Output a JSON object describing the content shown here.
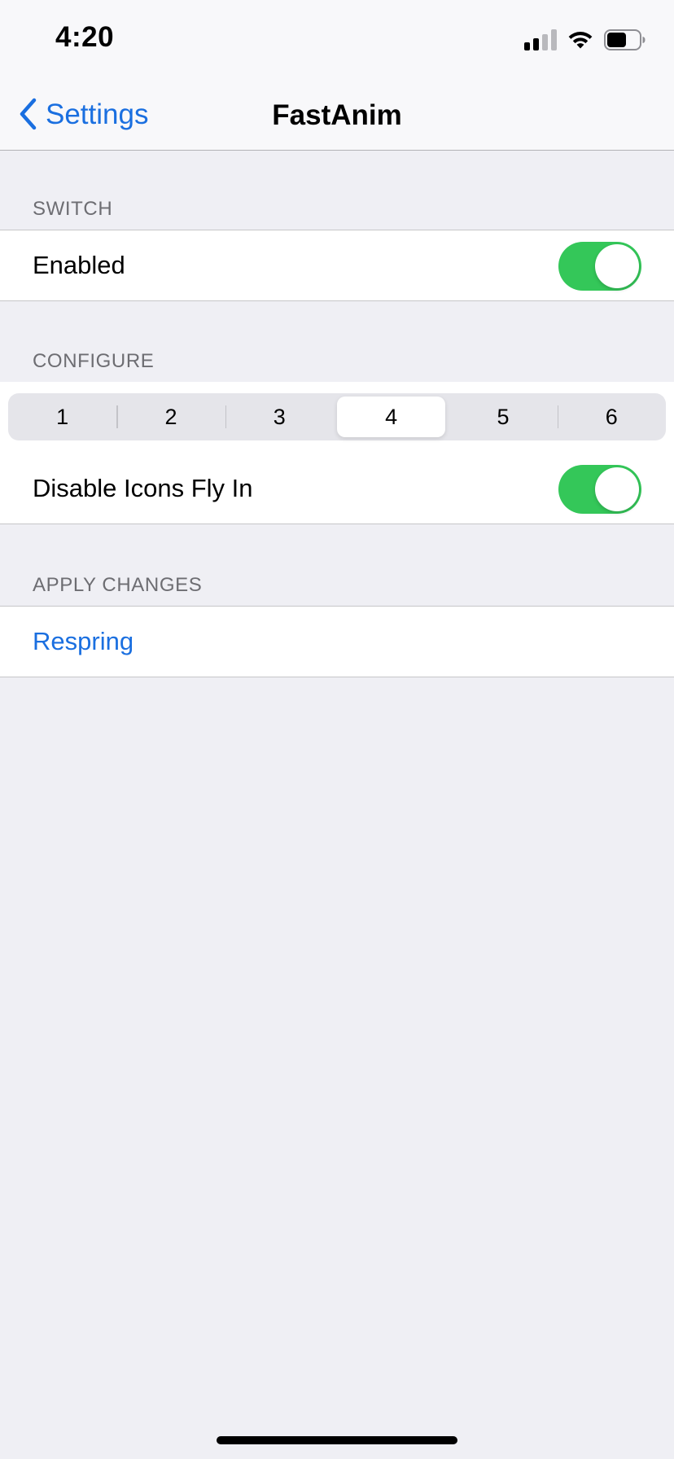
{
  "status_bar": {
    "time": "4:20",
    "signal_icon": "cellular-signal-icon",
    "wifi_icon": "wifi-icon",
    "battery_icon": "battery-icon",
    "battery_level": 0.6
  },
  "nav": {
    "back_label": "Settings",
    "back_icon": "chevron-left-icon",
    "title": "FastAnim"
  },
  "sections": {
    "switch": {
      "header": "SWITCH",
      "enabled_label": "Enabled",
      "enabled_on": true
    },
    "configure": {
      "header": "CONFIGURE",
      "segments": [
        "1",
        "2",
        "3",
        "4",
        "5",
        "6"
      ],
      "selected_segment": "4",
      "disable_icons_label": "Disable Icons Fly In",
      "disable_icons_on": true
    },
    "apply": {
      "header": "APPLY CHANGES",
      "respring_label": "Respring"
    }
  },
  "colors": {
    "accent": "#1a6fe0",
    "toggle_on": "#34c759",
    "background": "#efeff4"
  }
}
